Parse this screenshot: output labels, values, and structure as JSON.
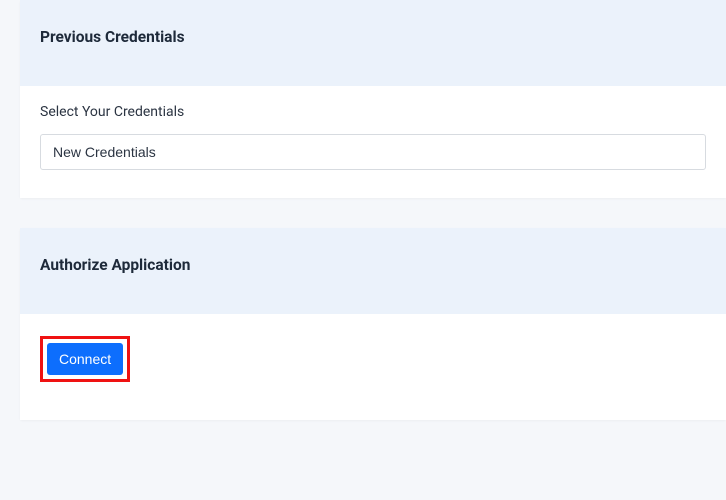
{
  "credentials_card": {
    "title": "Previous Credentials",
    "field_label": "Select Your Credentials",
    "selected_value": "New Credentials"
  },
  "authorize_card": {
    "title": "Authorize Application",
    "connect_label": "Connect"
  }
}
